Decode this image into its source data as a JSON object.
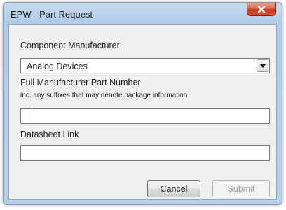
{
  "window": {
    "title": "EPW - Part Request",
    "close_glyph": "x",
    "icon_names": {
      "close": "close-icon",
      "dropdown": "chevron-down-icon"
    },
    "colors": {
      "close_button": "#c4391f",
      "titlebar": "#bcd3ec",
      "client_background": "#f0f0f0"
    }
  },
  "form": {
    "manufacturer_label": "Component Manufacturer",
    "manufacturer_selected": "Analog Devices",
    "part_number_label": "Full Manufacturer Part Number",
    "part_number_hint": "inc. any suffixes that may denote package information",
    "part_number_value": "",
    "datasheet_label": "Datasheet Link",
    "datasheet_value": ""
  },
  "buttons": {
    "cancel_label": "Cancel",
    "submit_label": "Submit",
    "submit_enabled": false
  }
}
